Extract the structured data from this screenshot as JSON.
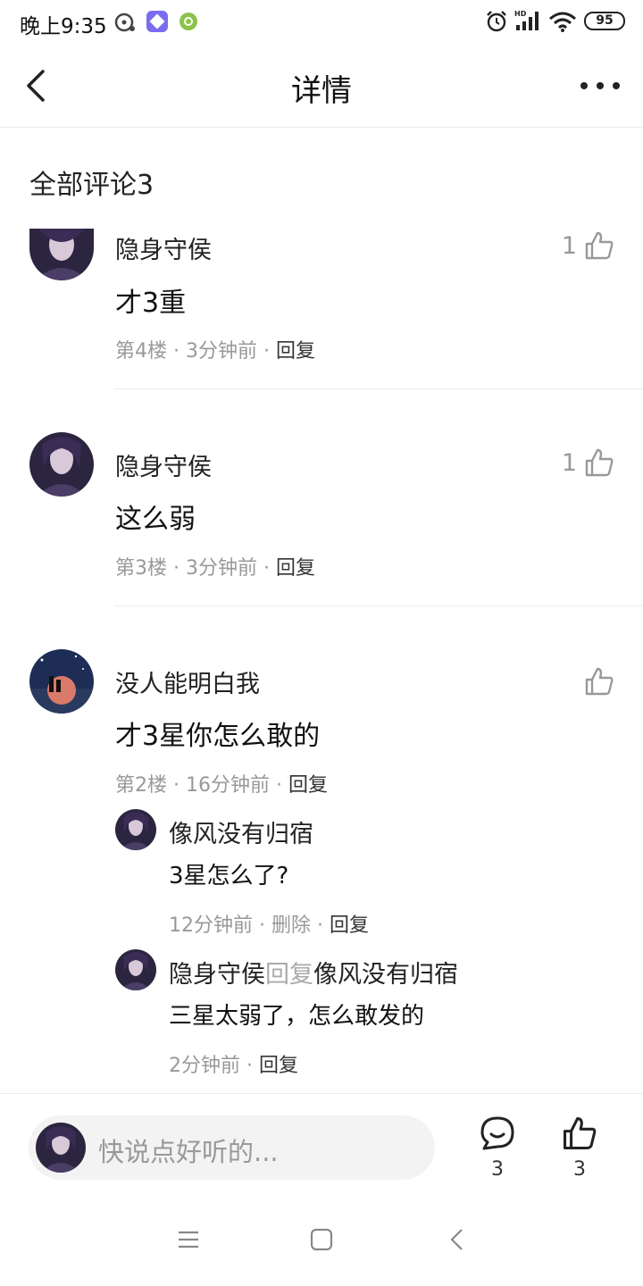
{
  "status_bar": {
    "time": "晚上9:35",
    "battery": "95"
  },
  "nav": {
    "title": "详情"
  },
  "section": {
    "title": "全部评论3"
  },
  "comments": [
    {
      "username": "隐身守侯",
      "content": "才3重",
      "floor": "第4楼",
      "time": "3分钟前",
      "reply_label": "回复",
      "likes": "1"
    },
    {
      "username": "隐身守侯",
      "content": "这么弱",
      "floor": "第3楼",
      "time": "3分钟前",
      "reply_label": "回复",
      "likes": "1"
    },
    {
      "username": "没人能明白我",
      "content": "才3星你怎么敢的",
      "floor": "第2楼",
      "time": "16分钟前",
      "reply_label": "回复",
      "likes": "",
      "replies": [
        {
          "username": "像风没有归宿",
          "content": "3星怎么了?",
          "time": "12分钟前",
          "delete_label": "删除",
          "reply_label": "回复"
        },
        {
          "username": "隐身守侯",
          "reply_word": "回复",
          "target": "像风没有归宿",
          "content": "三星太弱了，怎么敢发的",
          "time": "2分钟前",
          "reply_label": "回复"
        }
      ]
    }
  ],
  "separator": "·",
  "bottom_bar": {
    "placeholder": "快说点好听的...",
    "comment_count": "3",
    "like_count": "3"
  }
}
